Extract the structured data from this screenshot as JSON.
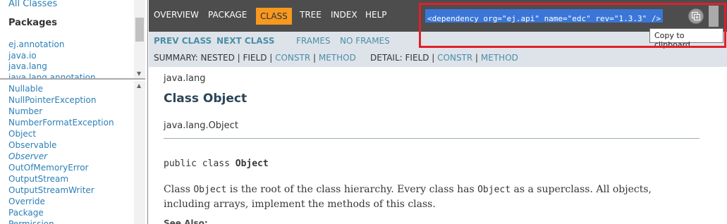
{
  "left_top": {
    "all_classes": "All Classes",
    "packages_heading": "Packages",
    "packages": [
      "ej.annotation",
      "java.io",
      "java.lang",
      "java.lang.annotation"
    ]
  },
  "left_bottom": {
    "classes": [
      {
        "label": "Nullable",
        "italic": false
      },
      {
        "label": "NullPointerException",
        "italic": false
      },
      {
        "label": "Number",
        "italic": false
      },
      {
        "label": "NumberFormatException",
        "italic": false
      },
      {
        "label": "Object",
        "italic": false
      },
      {
        "label": "Observable",
        "italic": false
      },
      {
        "label": "Observer",
        "italic": true
      },
      {
        "label": "OutOfMemoryError",
        "italic": false
      },
      {
        "label": "OutputStream",
        "italic": false
      },
      {
        "label": "OutputStreamWriter",
        "italic": false
      },
      {
        "label": "Override",
        "italic": false
      },
      {
        "label": "Package",
        "italic": false
      },
      {
        "label": "Permission",
        "italic": false
      }
    ]
  },
  "navbar": {
    "overview": "OVERVIEW",
    "package": "PACKAGE",
    "class": "CLASS",
    "tree": "TREE",
    "index": "INDEX",
    "help": "HELP",
    "dependency": "<dependency org=\"ej.api\" name=\"edc\" rev=\"1.3.3\" />",
    "copy_tooltip": "Copy to clipboard"
  },
  "subnav": {
    "prev_class": "PREV CLASS",
    "next_class": "NEXT CLASS",
    "frames": "FRAMES",
    "no_frames": "NO FRAMES",
    "summary_prefix": "SUMMARY: NESTED | FIELD | ",
    "summary_constr": "CONSTR",
    "summary_sep": " | ",
    "summary_method": "METHOD",
    "detail_prefix": "DETAIL: FIELD | ",
    "detail_constr": "CONSTR",
    "detail_sep": " | ",
    "detail_method": "METHOD"
  },
  "content": {
    "package_name": "java.lang",
    "class_title": "Class Object",
    "inheritance": "java.lang.Object",
    "declaration_prefix": "public class ",
    "declaration_name": "Object",
    "description_parts": [
      "Class ",
      "Object",
      " is the root of the class hierarchy. Every class has ",
      "Object",
      " as a superclass. All objects, including arrays, implement the methods of this class."
    ],
    "see_also": "See Also:"
  },
  "colors": {
    "navbar_bg": "#4d4d4d",
    "active_tab": "#f8981d",
    "subnav_bg": "#dee3e9",
    "link": "#2c7fb8",
    "highlight_border": "#e0202a",
    "selection": "#3a76d8"
  }
}
